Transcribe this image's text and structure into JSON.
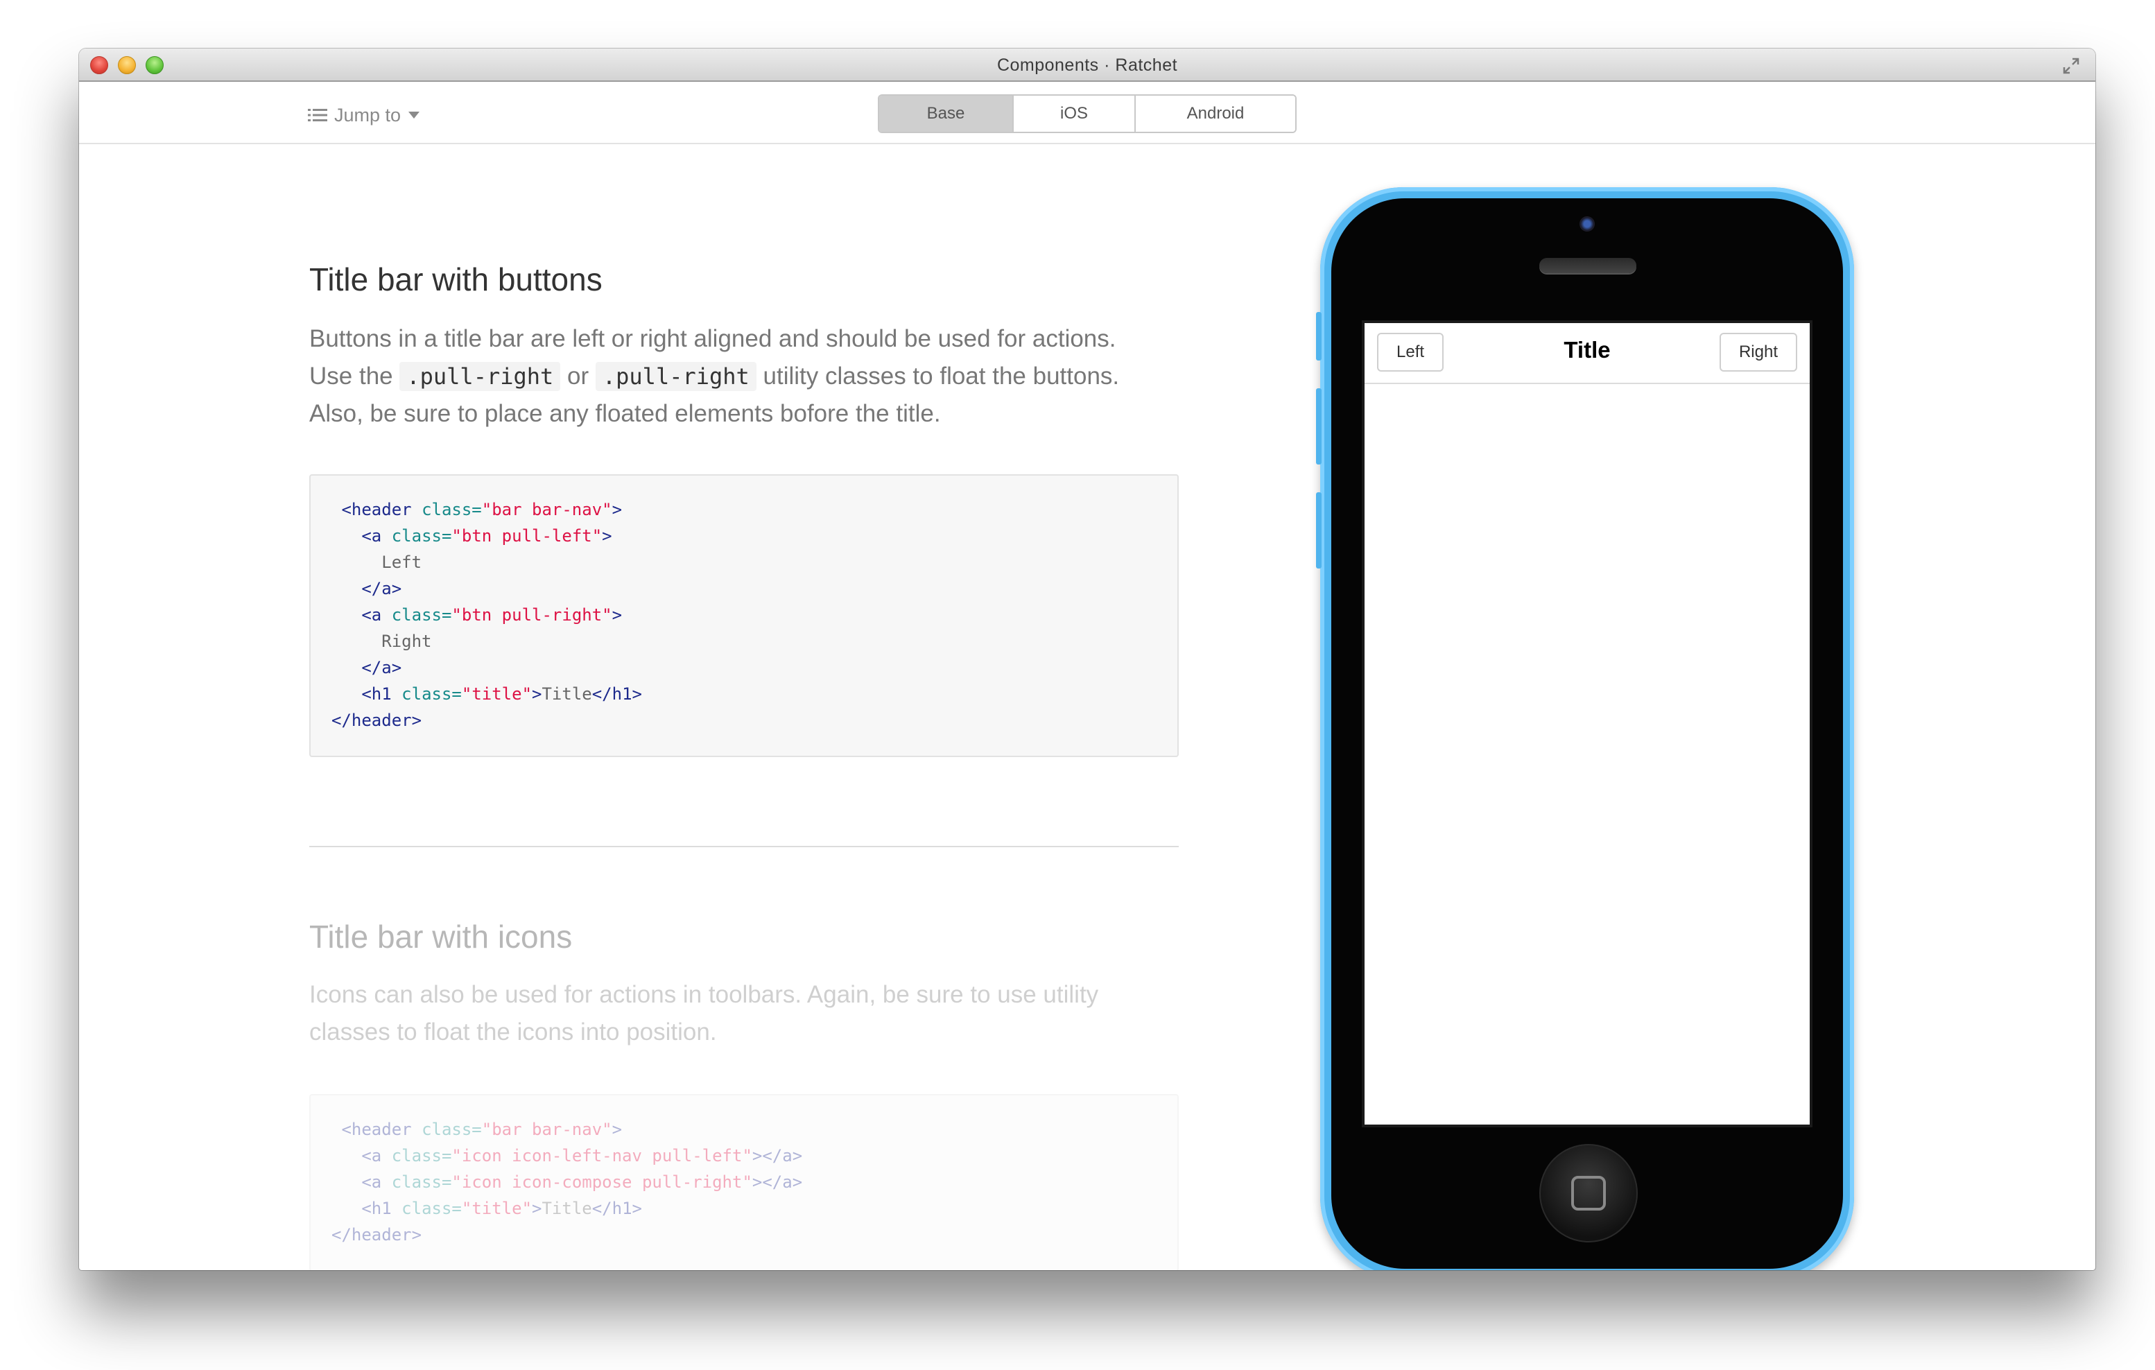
{
  "window": {
    "title": "Components · Ratchet"
  },
  "toolbar": {
    "jump_label": "Jump to",
    "tabs": [
      {
        "label": "Base",
        "active": true
      },
      {
        "label": "iOS",
        "active": false
      },
      {
        "label": "Android",
        "active": false
      }
    ]
  },
  "section1": {
    "heading": "Title bar with buttons",
    "para_1": "Buttons in a title bar are left or right aligned and should be used for actions.",
    "para_2_pre": "Use the",
    "code_a": ".pull-right",
    "para_2_mid": "or",
    "code_b": ".pull-right",
    "para_2_post": "utility classes to float the buttons.",
    "para_3": "Also, be sure to place any floated elements bofore the title.",
    "code": {
      "l1_open": "<header",
      "l1_attr": "class=",
      "l1_str": "\"bar bar-nav\"",
      "l1_close": ">",
      "l2_open": "<a",
      "l2_attr": "class=",
      "l2_str": "\"btn pull-left\"",
      "l2_close": ">",
      "l3_txt": "Left",
      "l4_tag": "</a>",
      "l5_open": "<a",
      "l5_attr": "class=",
      "l5_str": "\"btn pull-right\"",
      "l5_close": ">",
      "l6_txt": "Right",
      "l7_tag": "</a>",
      "l8_open": "<h1",
      "l8_attr": "class=",
      "l8_str": "\"title\"",
      "l8_gt": ">",
      "l8_txt": "Title",
      "l8_close": "</h1>",
      "l9_tag": "</header>"
    }
  },
  "section2": {
    "heading": "Title bar with icons",
    "para": "Icons can also be used for actions in toolbars. Again, be sure to use utility classes to float the icons into position.",
    "code": {
      "l1_open": "<header",
      "l1_attr": "class=",
      "l1_str": "\"bar bar-nav\"",
      "l1_close": ">",
      "l2_open": "<a",
      "l2_attr": "class=",
      "l2_str": "\"icon icon-left-nav pull-left\"",
      "l2_close": "></a>",
      "l3_open": "<a",
      "l3_attr": "class=",
      "l3_str": "\"icon icon-compose pull-right\"",
      "l3_close": "></a>",
      "l4_open": "<h1",
      "l4_attr": "class=",
      "l4_str": "\"title\"",
      "l4_gt": ">",
      "l4_txt": "Title",
      "l4_close": "</h1>",
      "l5_tag": "</header>"
    }
  },
  "phone": {
    "left_button": "Left",
    "title": "Title",
    "right_button": "Right",
    "body_color": "#4fb4ee"
  }
}
